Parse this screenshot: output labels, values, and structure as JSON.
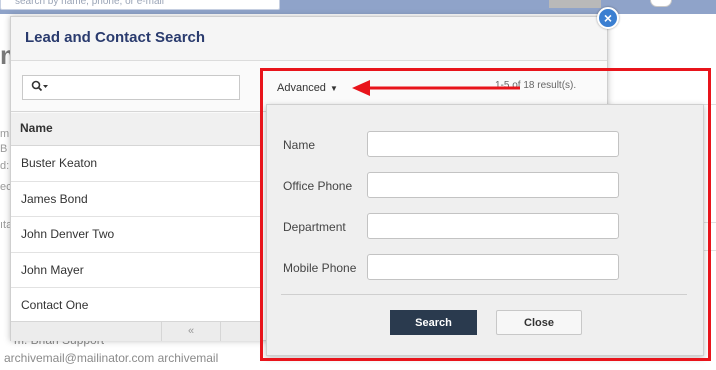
{
  "background": {
    "search_placeholder": "search by name, phone, or e-mail",
    "support_text": "m. Brian Support",
    "email_text": "archivemail@mailinator.com archivemail",
    "title_fragment": "m",
    "row_fragments": [
      "m",
      "B",
      "d:",
      "ec",
      "ıta"
    ]
  },
  "modal": {
    "title": "Lead and Contact Search",
    "close_icon": "close-icon",
    "search_icon": "search-icon",
    "advanced_label": "Advanced",
    "results_text": "1-5 of 18 result(s).",
    "list_header": "Name",
    "contacts": [
      "Buster Keaton",
      "James Bond",
      "John Denver Two",
      "John Mayer",
      "Contact One"
    ],
    "pager_prev": "«"
  },
  "advanced_panel": {
    "fields": [
      {
        "label": "Name",
        "value": ""
      },
      {
        "label": "Office Phone",
        "value": ""
      },
      {
        "label": "Department",
        "value": ""
      },
      {
        "label": "Mobile Phone",
        "value": ""
      }
    ],
    "search_button": "Search",
    "close_button": "Close"
  },
  "colors": {
    "highlight": "#e8141b",
    "title": "#2a3b6e",
    "search_button_bg": "#2a3a4e",
    "close_icon_bg": "#3b7fd1"
  }
}
